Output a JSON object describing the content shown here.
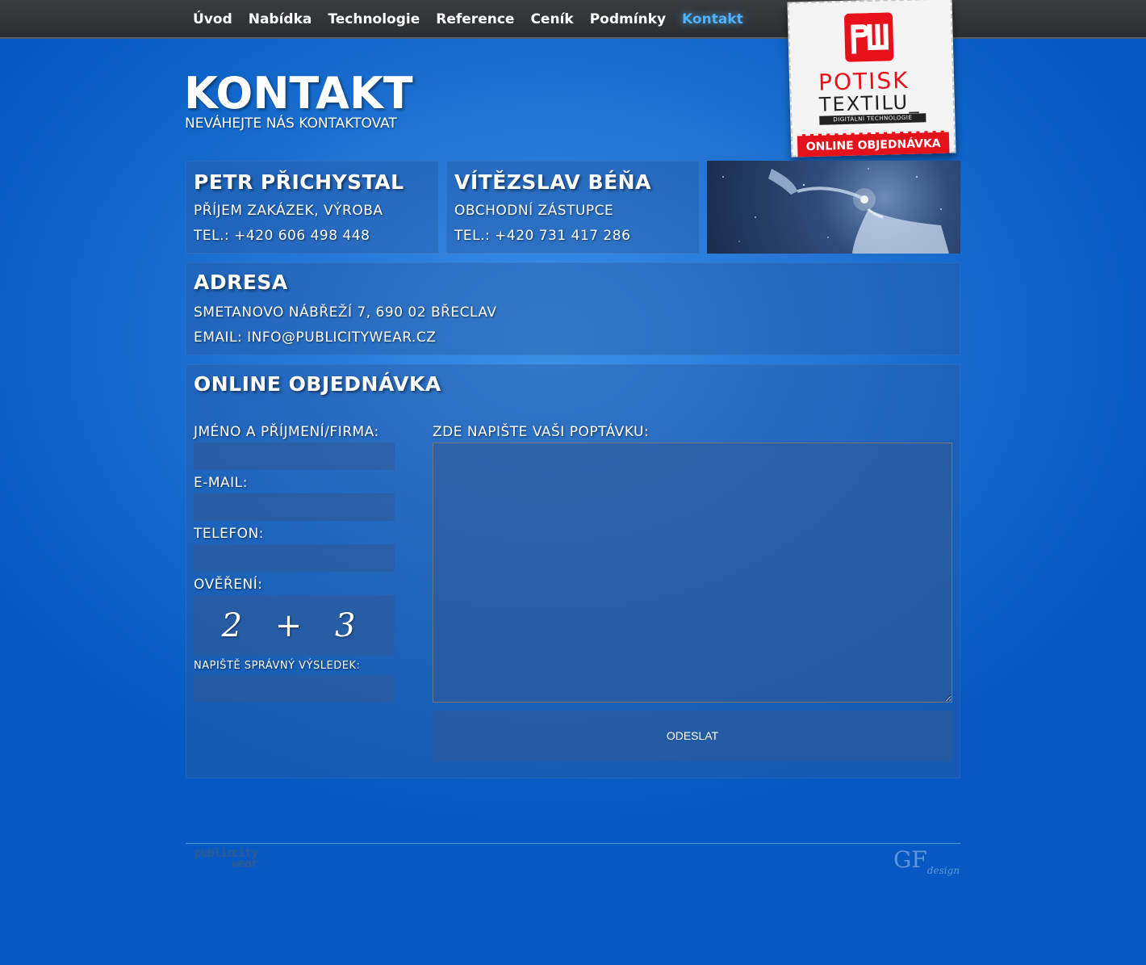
{
  "nav": {
    "items": [
      "Úvod",
      "Nabídka",
      "Technologie",
      "Reference",
      "Ceník",
      "Podmínky",
      "Kontakt"
    ],
    "active": "Kontakt"
  },
  "badge": {
    "line1": "POTISK",
    "line2": "TEXTILU_",
    "line3": "DIGITÁLNÍ TECHNOLOGIE",
    "button": "ONLINE OBJEDNÁVKA"
  },
  "header": {
    "title": "KONTAKT",
    "subtitle": "NEVÁHEJTE NÁS KONTAKTOVAT"
  },
  "contacts": [
    {
      "name": "PETR PŘICHYSTAL",
      "role": "PŘÍJEM ZAKÁZEK, VÝROBA",
      "phone": "TEL.: +420 606 498 448"
    },
    {
      "name": "VÍTĚZSLAV BÉŇA",
      "role": "OBCHODNÍ ZÁSTUPCE",
      "phone": "TEL.: +420 731 417 286"
    }
  ],
  "address": {
    "heading": "ADRESA",
    "street": "SMETANOVO NÁBŘEŽÍ 7, 690 02 BŘECLAV",
    "email": "EMAIL: INFO@PUBLICITYWEAR.CZ"
  },
  "order": {
    "heading": "ONLINE OBJEDNÁVKA",
    "name_label": "JMÉNO A PŘÍJMENÍ/FIRMA:",
    "email_label": "E-MAIL:",
    "phone_label": "TELEFON:",
    "verify_label": "OVĚŘENÍ:",
    "captcha": "2 + 3",
    "result_label": "NAPIŠTĚ SPRÁVNÝ VÝSLEDEK:",
    "message_label": "ZDE NAPIŠTE VAŠI POPTÁVKU:",
    "submit_label": "ODESLAT"
  },
  "footer": {
    "logo_line1": "public",
    "logo_line2": "city",
    "logo_line3": "wear",
    "credit": "GF",
    "credit_small": "design"
  },
  "colors": {
    "accent_nav": "#4fb2ff",
    "badge_red": "#e5121b",
    "background": "#0e64c8"
  }
}
